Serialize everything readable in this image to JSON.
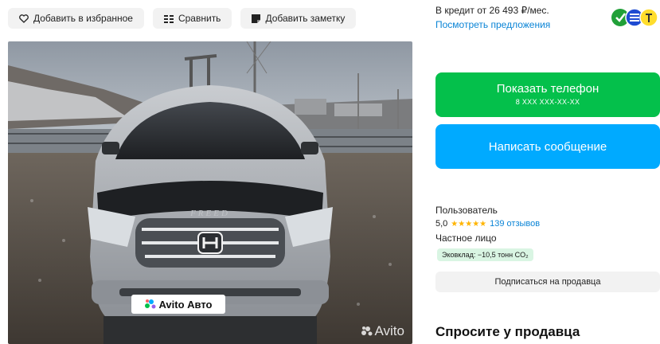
{
  "toolbar": {
    "favorite_label": "Добавить в избранное",
    "compare_label": "Сравнить",
    "note_label": "Добавить заметку"
  },
  "photo": {
    "grille_badge": "FREED",
    "plate_text": "Avito Авто",
    "watermark": "Avito"
  },
  "credit": {
    "text": "В кредит от 26 493 ₽/мес.",
    "link": "Посмотреть предложения"
  },
  "actions": {
    "phone_label": "Показать телефон",
    "phone_mask": "8 XXX XXX-XX-XX",
    "message_label": "Написать сообщение",
    "subscribe_label": "Подписаться на продавца"
  },
  "seller": {
    "name": "Пользователь",
    "rating": "5,0",
    "stars": "★★★★★",
    "reviews": "139 отзывов",
    "type": "Частное лицо",
    "eco": "Эковклад: −10,5 тонн CO₂"
  },
  "ask": {
    "title": "Спросите у продавца"
  },
  "colors": {
    "phone_button": "#04c04b",
    "message_button": "#00aaff",
    "link": "#0a84d6",
    "star": "#ffb400"
  }
}
